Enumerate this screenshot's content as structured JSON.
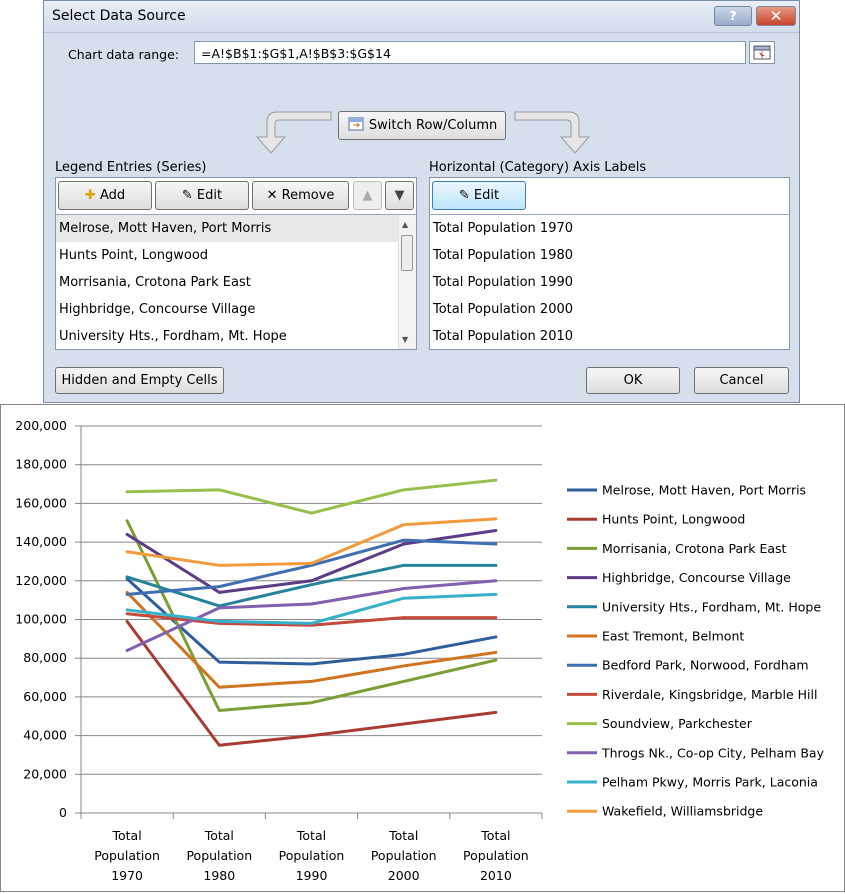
{
  "dialog": {
    "title": "Select Data Source",
    "help_symbol": "?",
    "close_symbol": "✕",
    "range_label": "Chart data range:",
    "range_value": "=A!$B$1:$G$1,A!$B$3:$G$14",
    "switch_label": "Switch Row/Column",
    "legend_label": "Legend Entries (Series)",
    "axis_label": "Horizontal (Category) Axis Labels",
    "add_label": "Add",
    "edit_label": "Edit",
    "remove_label": "Remove",
    "axis_edit_label": "Edit",
    "series_list": [
      "Melrose, Mott Haven, Port Morris",
      "Hunts Point, Longwood",
      "Morrisania, Crotona Park East",
      "Highbridge, Concourse Village",
      "University Hts., Fordham, Mt. Hope"
    ],
    "category_list": [
      "Total Population 1970",
      "Total Population 1980",
      "Total Population 1990",
      "Total Population 2000",
      "Total Population 2010"
    ],
    "hidden_label": "Hidden and Empty Cells",
    "ok_label": "OK",
    "cancel_label": "Cancel"
  },
  "chart_data": {
    "type": "line",
    "categories": [
      [
        "Total",
        "Population",
        "1970"
      ],
      [
        "Total",
        "Population",
        "1980"
      ],
      [
        "Total",
        "Population",
        "1990"
      ],
      [
        "Total",
        "Population",
        "2000"
      ],
      [
        "Total",
        "Population",
        "2010"
      ]
    ],
    "ylim": [
      0,
      200000
    ],
    "yticks": [
      "0",
      "20,000",
      "40,000",
      "60,000",
      "80,000",
      "100,000",
      "120,000",
      "140,000",
      "160,000",
      "180,000",
      "200,000"
    ],
    "grid": true,
    "legend_position": "right",
    "series": [
      {
        "name": "Melrose, Mott Haven, Port Morris",
        "color": "#2e5e9b",
        "values": [
          121000,
          78000,
          77000,
          82000,
          91000
        ]
      },
      {
        "name": "Hunts Point, Longwood",
        "color": "#a83c33",
        "values": [
          99000,
          35000,
          40000,
          46000,
          52000
        ]
      },
      {
        "name": "Morrisania, Crotona Park East",
        "color": "#7b9f35",
        "values": [
          151000,
          53000,
          57000,
          68000,
          79000
        ]
      },
      {
        "name": "Highbridge, Concourse Village",
        "color": "#5c3c86",
        "values": [
          144000,
          114000,
          120000,
          139000,
          146000
        ]
      },
      {
        "name": "University Hts., Fordham, Mt. Hope",
        "color": "#25849c",
        "values": [
          122000,
          107000,
          118000,
          128000,
          128000
        ]
      },
      {
        "name": "East Tremont, Belmont",
        "color": "#d2731f",
        "values": [
          114000,
          65000,
          68000,
          76000,
          83000
        ]
      },
      {
        "name": "Bedford Park, Norwood, Fordham",
        "color": "#3e6fb3",
        "values": [
          113000,
          117000,
          128000,
          141000,
          139000
        ]
      },
      {
        "name": "Riverdale, Kingsbridge, Marble Hill",
        "color": "#c5493d",
        "values": [
          103000,
          98000,
          97000,
          101000,
          101000
        ]
      },
      {
        "name": "Soundview, Parkchester",
        "color": "#98bf4c",
        "values": [
          166000,
          167000,
          155000,
          167000,
          172000
        ]
      },
      {
        "name": "Throgs Nk., Co-op City, Pelham Bay",
        "color": "#8260b0",
        "values": [
          84000,
          106000,
          108000,
          116000,
          120000
        ]
      },
      {
        "name": "Pelham Pkwy, Morris Park, Laconia",
        "color": "#36b1cc",
        "values": [
          105000,
          99000,
          98000,
          111000,
          113000
        ]
      },
      {
        "name": "Wakefield, Williamsbridge",
        "color": "#f39a3c",
        "values": [
          135000,
          128000,
          129000,
          149000,
          152000
        ]
      }
    ]
  }
}
